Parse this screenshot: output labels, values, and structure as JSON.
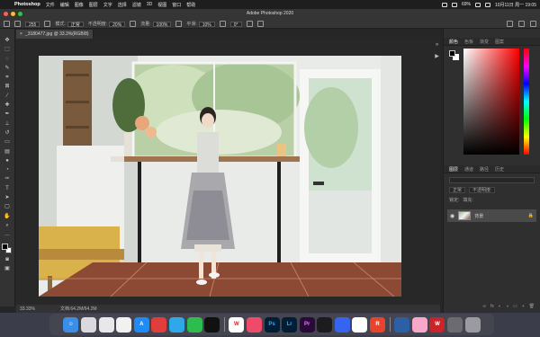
{
  "menubar": {
    "app_name": "Photoshop",
    "items": [
      "文件",
      "编辑",
      "图像",
      "图层",
      "文字",
      "选择",
      "滤镜",
      "3D",
      "视图",
      "窗口",
      "帮助"
    ],
    "battery": "69%",
    "clock": "10月11日 周一 19:05"
  },
  "window": {
    "title": "Adobe Photoshop 2020"
  },
  "options": {
    "brush_size": "255",
    "mode_label": "模式:",
    "mode_value": "正常",
    "opacity_label": "不透明度:",
    "opacity_value": "20%",
    "flow_label": "流量:",
    "flow_value": "100%",
    "smooth_label": "平滑:",
    "smooth_value": "10%",
    "angle_value": "0°"
  },
  "document": {
    "tab_label": "_3180477.jpg @ 33.3%(RGB/8)",
    "zoom": "33.33%",
    "doc_size": "文档:64.2M/64.2M"
  },
  "panels": {
    "color_tabs": [
      "颜色",
      "色板",
      "渐变",
      "图案"
    ],
    "layer_tabs": [
      "图层",
      "通道",
      "路径",
      "历史"
    ],
    "kind_label": "类型",
    "blend_mode": "正常",
    "opacity_label": "不透明度:",
    "lock_label": "锁定:",
    "fill_label": "填充:",
    "layer_name": "背景",
    "colors": {
      "fg": "#000000",
      "bg": "#ffffff",
      "hue": "#ff0000"
    }
  },
  "tools": [
    "move-icon",
    "marquee-icon",
    "lasso-icon",
    "quick-select-icon",
    "crop-icon",
    "frame-icon",
    "eyedropper-icon",
    "healing-icon",
    "brush-icon",
    "stamp-icon",
    "history-brush-icon",
    "eraser-icon",
    "gradient-icon",
    "blur-icon",
    "dodge-icon",
    "pen-icon",
    "type-icon",
    "path-select-icon",
    "rectangle-icon",
    "hand-icon",
    "zoom-icon"
  ],
  "dock": [
    "finder",
    "launchpad",
    "safari",
    "chrome",
    "appstore",
    "mail",
    "wechat",
    "qq",
    "music",
    "edit",
    "ps",
    "lr",
    "pr",
    "media",
    "baidu",
    "pdf",
    "gallery",
    "wps",
    "trash"
  ]
}
